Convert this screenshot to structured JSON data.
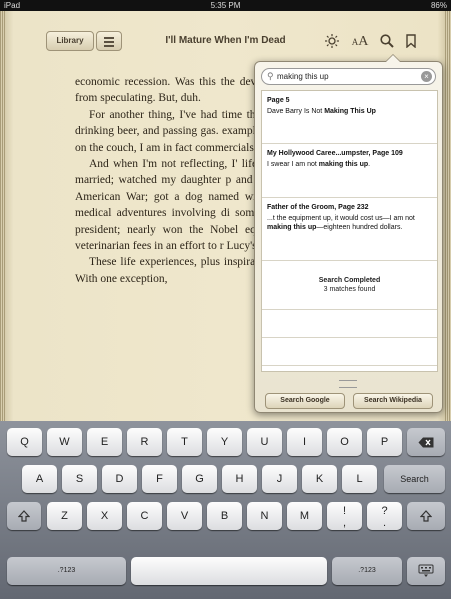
{
  "status_bar": {
    "carrier": "iPad",
    "time": "5:35 PM",
    "battery": "86%"
  },
  "toolbar": {
    "library_label": "Library",
    "book_title": "I'll Mature When I'm Dead",
    "font_size_label": "AA"
  },
  "book": {
    "paragraphs": [
      "economic recession. Was this the devastated by the loss of my colu from speculating. But, duh.",
      "For another thing, I've had time think that all I do in retirement i drinking beer, and passing gas. example. But when I appear to be flesh on the couch, I am in fact commercials.",
      "And when I'm not reflecting, I' life experiences. In the past few y married; watched my daughter p and perform in ballet recitals lastin American War; got a dog named with Clarabelle the famous Walt medical adventures involving di some of my most personal regions president; nearly won the Nobel equivalent of the gross national veterinarian fees in an effort to r Lucy's tail caused by the fact that s",
      "These life experiences, plus inspiration for the essays in this book. With one exception,"
    ]
  },
  "search": {
    "query": "making this up",
    "results": [
      {
        "title": "Page 5",
        "snippet_pre": "Dave Barry Is Not ",
        "snippet_match": "Making This Up",
        "snippet_post": ""
      },
      {
        "title": "My Hollywood Caree...umpster, Page 109",
        "snippet_pre": "I swear I am not ",
        "snippet_match": "making this up",
        "snippet_post": "."
      },
      {
        "title": "Father of the Groom, Page 232",
        "snippet_pre": "...t the equipment up, it would cost us—I am not ",
        "snippet_match": "making this up",
        "snippet_post": "—eighteen hundred dollars."
      }
    ],
    "completed_title": "Search Completed",
    "completed_count": "3 matches found",
    "google_button": "Search Google",
    "wikipedia_button": "Search Wikipedia"
  },
  "keyboard": {
    "row1": [
      "Q",
      "W",
      "E",
      "R",
      "T",
      "Y",
      "U",
      "I",
      "O",
      "P"
    ],
    "row2": [
      "A",
      "S",
      "D",
      "F",
      "G",
      "H",
      "J",
      "K",
      "L"
    ],
    "row2_return": "Search",
    "row3": [
      "Z",
      "X",
      "C",
      "V",
      "B",
      "N",
      "M",
      "!",
      ",",
      " ?",
      "."
    ],
    "row3_keys": [
      {
        "top": "Z"
      },
      {
        "top": "X"
      },
      {
        "top": "C"
      },
      {
        "top": "V"
      },
      {
        "top": "B"
      },
      {
        "top": "N"
      },
      {
        "top": "M"
      },
      {
        "top": "!",
        "bottom": ","
      },
      {
        "top": "?",
        "bottom": "."
      }
    ],
    "numbers_label": ".?123"
  }
}
